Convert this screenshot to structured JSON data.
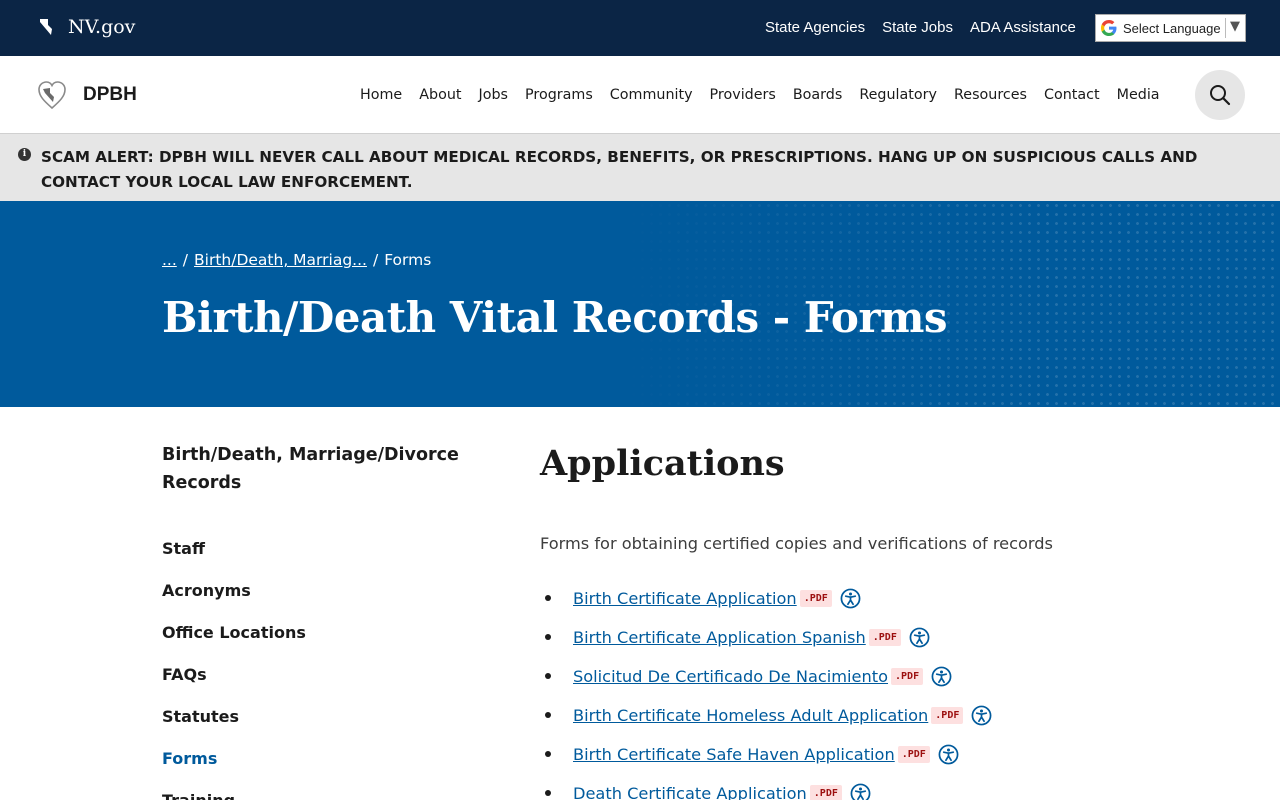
{
  "gov_bar": {
    "site_name": "NV.gov",
    "links": [
      "State Agencies",
      "State Jobs",
      "ADA Assistance"
    ],
    "language_select": "Select Language"
  },
  "header": {
    "agency": "DPBH",
    "nav": [
      "Home",
      "About",
      "Jobs",
      "Programs",
      "Community",
      "Providers",
      "Boards",
      "Regulatory",
      "Resources",
      "Contact",
      "Media"
    ]
  },
  "alert": {
    "text": "SCAM ALERT: DPBH WILL NEVER CALL ABOUT MEDICAL RECORDS, BENEFITS, OR PRESCRIPTIONS. HANG UP ON SUSPICIOUS CALLS AND CONTACT YOUR LOCAL LAW ENFORCEMENT."
  },
  "hero": {
    "breadcrumb": [
      "...",
      "Birth/Death, Marriag...",
      "Forms"
    ],
    "separator": "/",
    "title": "Birth/Death Vital Records - Forms"
  },
  "sidebar": {
    "title": "Birth/Death, Marriage/Divorce Records",
    "items": [
      "Staff",
      "Acronyms",
      "Office Locations",
      "FAQs",
      "Statutes",
      "Forms",
      "Training"
    ],
    "active_item": "Forms"
  },
  "main": {
    "heading": "Applications",
    "intro": "Forms for obtaining certified copies and verifications of records",
    "badge_label": ".PDF",
    "documents": [
      "Birth Certificate Application",
      "Birth Certificate Application Spanish",
      "Solicitud De Certificado De Nacimiento",
      "Birth Certificate Homeless Adult Application",
      "Birth Certificate Safe Haven Application",
      "Death Certificate Application"
    ]
  },
  "colors": {
    "gov_bar_bg": "#0b2545",
    "hero_bg": "#005a9c",
    "link": "#005a9c",
    "alert_bg": "#e6e6e6",
    "pdf_badge_bg": "#fde0e0",
    "pdf_badge_text": "#9c0f0f"
  },
  "icons": {
    "gov_logo": "nevada-state-icon",
    "site_logo": "dpbh-heart-icon",
    "search": "search-icon",
    "alert": "info-icon",
    "document": "accessibility-icon",
    "language": "google-icon"
  }
}
